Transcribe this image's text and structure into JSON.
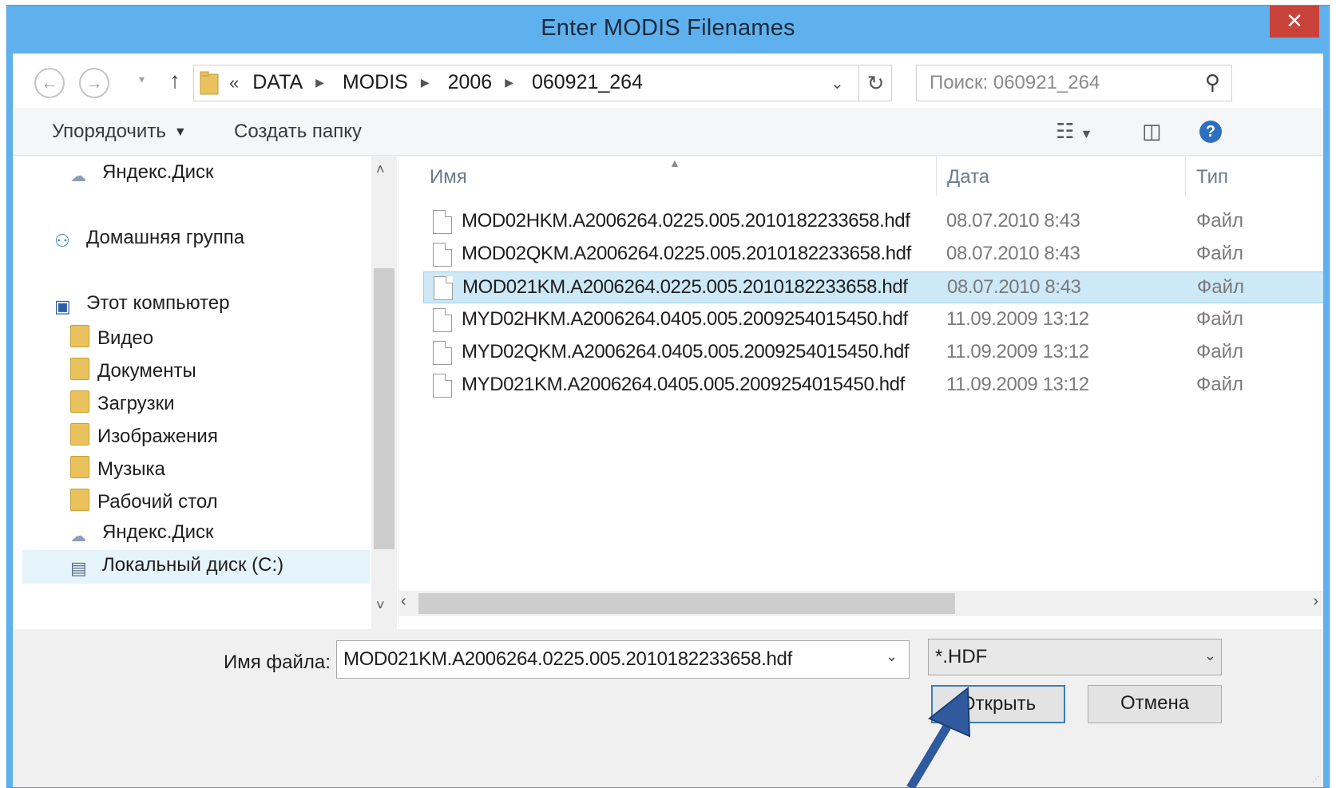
{
  "window": {
    "title": "Enter MODIS Filenames",
    "close_glyph": "✕"
  },
  "nav": {
    "back_glyph": "←",
    "forward_glyph": "→",
    "up_glyph": "↑",
    "dropdown_glyph": "▾",
    "breadcrumb_prefix": "«",
    "breadcrumbs": [
      "DATA",
      "MODIS",
      "2006",
      "060921_264"
    ],
    "search_placeholder": "Поиск: 060921_264"
  },
  "toolbar": {
    "organize": "Упорядочить",
    "new_folder": "Создать папку"
  },
  "sidebar": {
    "items": [
      {
        "label": "Яндекс.Диск",
        "icon": "cloud-icon"
      },
      {
        "label": "Домашняя группа",
        "icon": "homegroup-icon"
      },
      {
        "label": "Этот компьютер",
        "icon": "computer-icon"
      },
      {
        "label": "Видео",
        "icon": "folder-icon"
      },
      {
        "label": "Документы",
        "icon": "folder-icon"
      },
      {
        "label": "Загрузки",
        "icon": "folder-icon"
      },
      {
        "label": "Изображения",
        "icon": "folder-icon"
      },
      {
        "label": "Музыка",
        "icon": "folder-icon"
      },
      {
        "label": "Рабочий стол",
        "icon": "folder-icon"
      },
      {
        "label": "Яндекс.Диск",
        "icon": "cloud-icon"
      },
      {
        "label": "Локальный диск (C:)",
        "icon": "drive-icon"
      }
    ],
    "selected_index": 10
  },
  "columns": {
    "name": "Имя",
    "date": "Дата",
    "type": "Тип"
  },
  "files": [
    {
      "name": "MOD02HKM.A2006264.0225.005.2010182233658.hdf",
      "date": "08.07.2010 8:43",
      "type": "Файл"
    },
    {
      "name": "MOD02QKM.A2006264.0225.005.2010182233658.hdf",
      "date": "08.07.2010 8:43",
      "type": "Файл"
    },
    {
      "name": "MOD021KM.A2006264.0225.005.2010182233658.hdf",
      "date": "08.07.2010 8:43",
      "type": "Файл"
    },
    {
      "name": "MYD02HKM.A2006264.0405.005.2009254015450.hdf",
      "date": "11.09.2009 13:12",
      "type": "Файл"
    },
    {
      "name": "MYD02QKM.A2006264.0405.005.2009254015450.hdf",
      "date": "11.09.2009 13:12",
      "type": "Файл"
    },
    {
      "name": "MYD021KM.A2006264.0405.005.2009254015450.hdf",
      "date": "11.09.2009 13:12",
      "type": "Файл"
    }
  ],
  "selected_file_index": 2,
  "bottom": {
    "filename_label": "Имя файла:",
    "filename_value": "MOD021KM.A2006264.0225.005.2010182233658.hdf",
    "filter_value": "*.HDF",
    "open_button": "Открыть",
    "cancel_button": "Отмена"
  },
  "colors": {
    "titlebar": "#5fb1ee",
    "close": "#c9423a",
    "selection": "#cde8f7",
    "arrow": "#2f5a9e"
  }
}
